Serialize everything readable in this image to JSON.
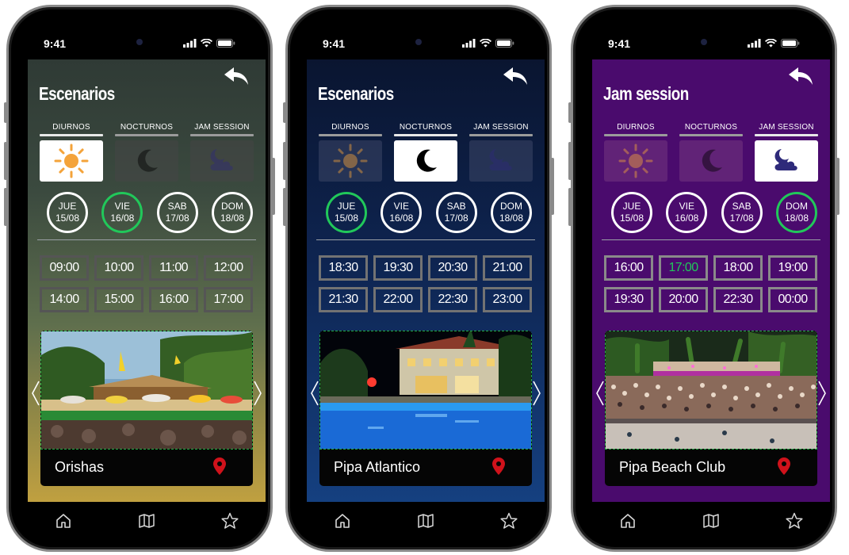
{
  "status": {
    "time": "9:41"
  },
  "categories_labels": [
    "DIURNOS",
    "NOCTURNOS",
    "JAM SESSION"
  ],
  "colors": {
    "active_green": "#21c85a",
    "pin_red": "#d0121b",
    "sun_orange": "#f4a33a",
    "cloud_indigo": "#2e2a7a"
  },
  "screens": [
    {
      "title": "Escenarios",
      "active_category": 0,
      "categories": [
        {
          "label": "DIURNOS",
          "icon": "sun-icon"
        },
        {
          "label": "NOCTURNOS",
          "icon": "moon-icon"
        },
        {
          "label": "JAM SESSION",
          "icon": "moon-cloud-icon"
        }
      ],
      "days": [
        {
          "weekday": "JUE",
          "date": "15/08"
        },
        {
          "weekday": "VIE",
          "date": "16/08",
          "selected": true
        },
        {
          "weekday": "SAB",
          "date": "17/08"
        },
        {
          "weekday": "DOM",
          "date": "18/08"
        }
      ],
      "times": [
        "09:00",
        "10:00",
        "11:00",
        "12:00",
        "14:00",
        "15:00",
        "16:00",
        "17:00"
      ],
      "venue": {
        "name": "Orishas"
      }
    },
    {
      "title": "Escenarios",
      "active_category": 1,
      "categories": [
        {
          "label": "DIURNOS",
          "icon": "sun-icon"
        },
        {
          "label": "NOCTURNOS",
          "icon": "moon-icon"
        },
        {
          "label": "JAM SESSION",
          "icon": "moon-cloud-icon"
        }
      ],
      "days": [
        {
          "weekday": "JUE",
          "date": "15/08",
          "selected": true
        },
        {
          "weekday": "VIE",
          "date": "16/08"
        },
        {
          "weekday": "SAB",
          "date": "17/08"
        },
        {
          "weekday": "DOM",
          "date": "18/08"
        }
      ],
      "times": [
        "18:30",
        "19:30",
        "20:30",
        "21:00",
        "21:30",
        "22:00",
        "22:30",
        "23:00"
      ],
      "venue": {
        "name": "Pipa Atlantico"
      }
    },
    {
      "title": "Jam session",
      "active_category": 2,
      "categories": [
        {
          "label": "DIURNOS",
          "icon": "sun-icon"
        },
        {
          "label": "NOCTURNOS",
          "icon": "moon-icon"
        },
        {
          "label": "JAM SESSION",
          "icon": "moon-cloud-icon"
        }
      ],
      "days": [
        {
          "weekday": "JUE",
          "date": "15/08"
        },
        {
          "weekday": "VIE",
          "date": "16/08"
        },
        {
          "weekday": "SAB",
          "date": "17/08"
        },
        {
          "weekday": "DOM",
          "date": "18/08",
          "selected": true
        }
      ],
      "times": [
        "16:00",
        "17:00",
        "18:00",
        "19:00",
        "19:30",
        "20:00",
        "22:30",
        "00:00"
      ],
      "active_time": 1,
      "venue": {
        "name": "Pipa Beach Club"
      }
    }
  ]
}
